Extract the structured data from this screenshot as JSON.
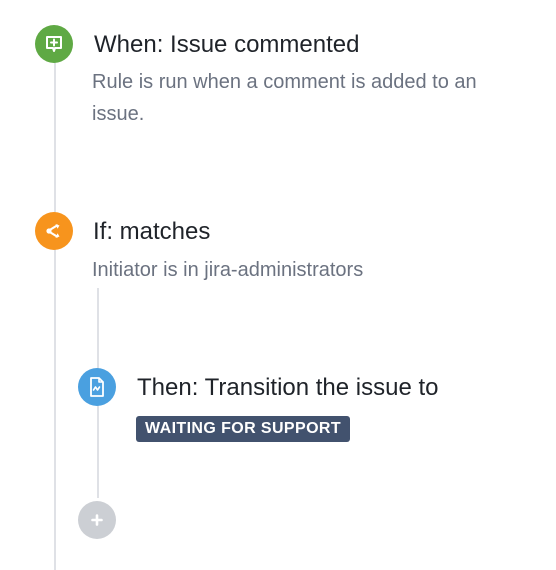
{
  "trigger": {
    "title": "When: Issue commented",
    "description": "Rule is run when a comment is added to an issue.",
    "icon": "comment-plus-icon",
    "color": "#5fa944"
  },
  "condition": {
    "title": "If: matches",
    "description": "Initiator is in jira-administrators",
    "icon": "branch-icon",
    "color": "#f7941d"
  },
  "action": {
    "title": "Then: Transition the issue to",
    "status": "WAITING FOR SUPPORT",
    "icon": "document-transition-icon",
    "color": "#4aa0e0",
    "status_color": "#42526e"
  },
  "add_component": {
    "icon": "plus-icon",
    "color": "#cccfd4"
  }
}
